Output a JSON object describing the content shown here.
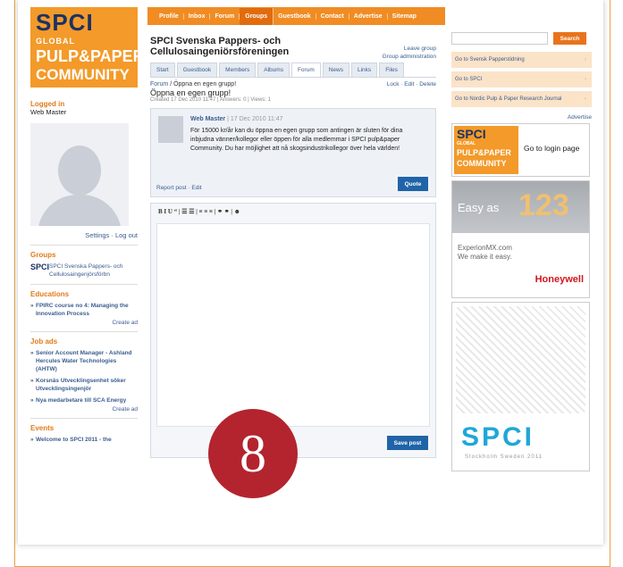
{
  "nav": [
    "Profile",
    "Inbox",
    "Forum",
    "Groups",
    "Guestbook",
    "Contact",
    "Advertise",
    "Sitemap"
  ],
  "nav_active": "Groups",
  "logo": {
    "line1": "SPCI",
    "line2": "GLOBAL",
    "line3": "PULP&PAPER",
    "line4": "COMMUNITY"
  },
  "left": {
    "logged_in_label": "Logged in",
    "user": "Web Master",
    "settings": "Settings",
    "logout": "Log out",
    "groups_h": "Groups",
    "group_logo": "SPCI",
    "group_name": "SPCI Svenska Pappers- och Cellulosaingenjörsförbn",
    "edu_h": "Educations",
    "edu_item": "FPIRC course no 4: Managing the Innovation Process",
    "create_ad": "Create ad",
    "jobs_h": "Job ads",
    "jobs": [
      "Senior Account Manager - Ashland Hercules Water Technologies (AHTW)",
      "Korsnäs Utvecklingsenhet söker Utvecklingsingenjör",
      "Nya medarbetare till SCA Energy"
    ],
    "create_ad2": "Create ad",
    "events_h": "Events",
    "event_item": "Welcome to SPCI 2011 - the"
  },
  "center": {
    "title": "SPCI Svenska Pappers- och Cellulosaingeniörsföreningen",
    "leave_group": "Leave group",
    "group_admin": "Group administration",
    "tabs": [
      "Start",
      "Guestbook",
      "Members",
      "Albums",
      "Forum",
      "News",
      "Links",
      "Files"
    ],
    "active_tab": "Forum",
    "crumb_forum": "Forum",
    "crumb_current": "/ Öppna en egen grupp!",
    "actions": "Lock  ·  Edit  ·  Delete",
    "post_title": "Öppna en egen grupp!",
    "meta": "Created 17 Dec 2010 11:47  |  Answers: 0  |  Views: 1",
    "author": "Web Master",
    "post_date": "|  17 Dec 2010 11:47",
    "body": "För 15000 kr/år kan du öppna en egen grupp som antingen är sluten för dina inbjudna vänner/kollegor eller öppen för alla medlemmar i SPCI pulp&paper Community. Du har möjlighet att nå skogsindustrikollegor över hela världen!",
    "report_edit": "Report post  ·  Edit",
    "quote": "Quote",
    "toolbar": "B  I  U  “  |  ☰  ☰  |  ≡  ≡  ≡  |  ⚭  ⚭  |  ☻",
    "save": "Save post",
    "badge": "8"
  },
  "right": {
    "search_btn": "Search",
    "links": [
      "Go to Svensk Papperstidning",
      "Go to SPCI",
      "Go to Nordic Pulp & Paper Research Journal"
    ],
    "advertise": "Advertise",
    "ad1_logo": [
      "SPCI",
      "GLOBAL",
      "PULP&PAPER",
      "COMMUNITY"
    ],
    "ad1_text": "Go to login page",
    "ad2_easy": "Easy as",
    "ad2_nums": "123",
    "ad2_url1": "ExperionMX.com",
    "ad2_url2": "We make it easy.",
    "ad2_brand": "Honeywell",
    "ad3_brand": "SPCI",
    "ad3_loc": "Stockholm Sweden 2011"
  },
  "colors": {
    "orange": "#f08c23",
    "navy": "#1b3263",
    "blue": "#2064a8",
    "badge": "#b3242e"
  }
}
